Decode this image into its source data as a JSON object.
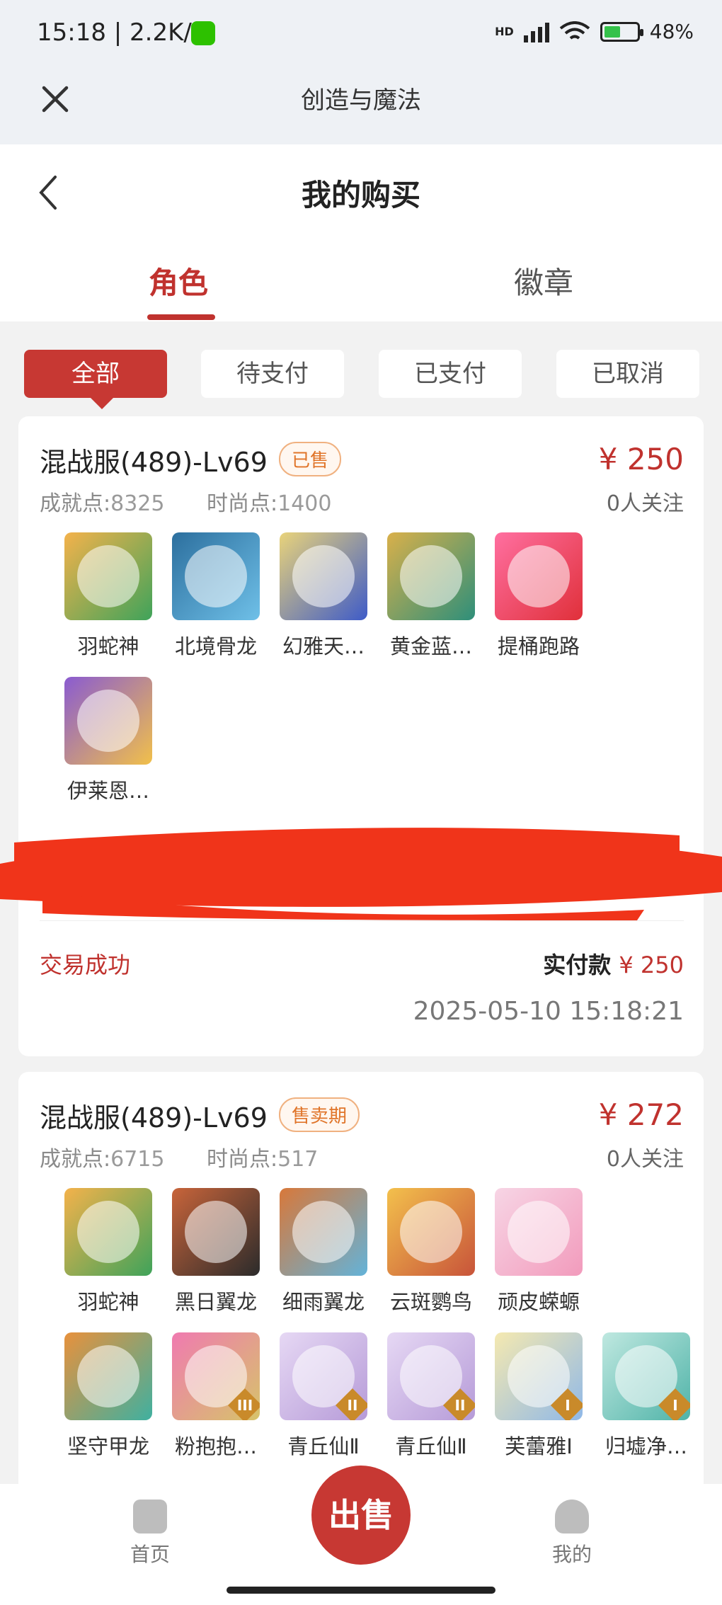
{
  "status_bar": {
    "time": "15:18 | 2.2K/s",
    "battery": "48%",
    "network": "HD"
  },
  "app_bar": {
    "title": "创造与魔法"
  },
  "header": {
    "title": "我的购买"
  },
  "tabs": [
    {
      "label": "角色",
      "active": true
    },
    {
      "label": "徽章",
      "active": false
    }
  ],
  "filters": [
    {
      "label": "全部",
      "active": true
    },
    {
      "label": "待支付",
      "active": false
    },
    {
      "label": "已支付",
      "active": false
    },
    {
      "label": "已取消",
      "active": false
    }
  ],
  "orders": [
    {
      "title": "混战服(489)-Lv69",
      "badge": "已售",
      "price": "¥ 250",
      "achievement_label": "成就点:",
      "achievement": "8325",
      "fashion_label": "时尚点:",
      "fashion": "1400",
      "watchers": "0人关注",
      "items": [
        "羽蛇神",
        "北境骨龙",
        "幻雅天…",
        "黄金蓝…",
        "提桶跑路",
        "伊莱恩…"
      ],
      "status": "交易成功",
      "paid_label": "实付款",
      "paid_amount": "¥ 250",
      "datetime": "2025-05-10 15:18:21"
    },
    {
      "title": "混战服(489)-Lv69",
      "badge": "售卖期",
      "price": "¥ 272",
      "achievement_label": "成就点:",
      "achievement": "6715",
      "fashion_label": "时尚点:",
      "fashion": "517",
      "watchers": "0人关注",
      "items": [
        "羽蛇神",
        "黑日翼龙",
        "细雨翼龙",
        "云斑鹦鸟",
        "顽皮蝾螈",
        "坚守甲龙",
        "粉抱抱…",
        "青丘仙Ⅱ",
        "青丘仙Ⅱ",
        "芙蕾雅Ⅰ",
        "归墟净…"
      ]
    }
  ],
  "bottom_nav": {
    "home": "首页",
    "sell": "出售",
    "mine": "我的"
  },
  "colors": {
    "accent": "#c0322e",
    "badge": "#e0752a",
    "background": "#f2f2f2"
  }
}
